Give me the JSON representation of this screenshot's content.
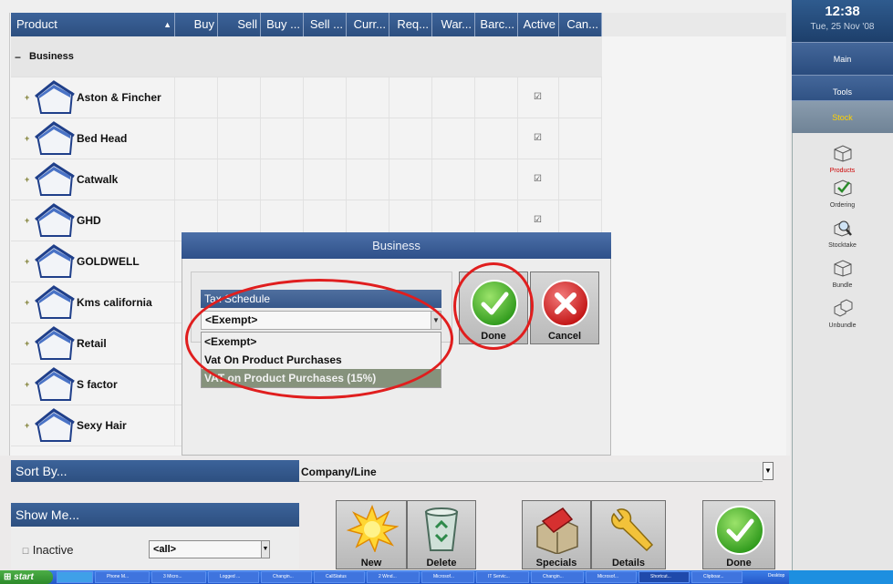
{
  "grid": {
    "columns": [
      "Product",
      "Buy",
      "Sell",
      "Buy ...",
      "Sell ...",
      "Curr...",
      "Req...",
      "War...",
      "Barc...",
      "Active",
      "Can..."
    ],
    "group_label": "Business",
    "rows": [
      {
        "label": "Aston & Fincher",
        "active": true
      },
      {
        "label": "Bed Head",
        "active": true
      },
      {
        "label": "Catwalk",
        "active": true
      },
      {
        "label": "GHD",
        "active": true
      },
      {
        "label": "GOLDWELL",
        "active": false
      },
      {
        "label": "Kms california",
        "active": false
      },
      {
        "label": "Retail",
        "active": false
      },
      {
        "label": "S factor",
        "active": true
      },
      {
        "label": "Sexy Hair",
        "active": true
      }
    ]
  },
  "dialog": {
    "title": "Business",
    "tax_schedule_label": "Tax Schedule",
    "tax_schedule_value": "<Exempt>",
    "options": [
      "<Exempt>",
      "Vat On Product Purchases",
      "VAT on Product Purchases (15%)"
    ],
    "selected_option_index": 2,
    "done_label": "Done",
    "cancel_label": "Cancel"
  },
  "sort": {
    "label": "Sort By...",
    "value": "Company/Line"
  },
  "show": {
    "label": "Show Me...",
    "inactive_label": "Inactive",
    "filter_value": "<all>"
  },
  "toolbar": {
    "new_label": "New",
    "delete_label": "Delete",
    "specials_label": "Specials",
    "details_label": "Details",
    "done_label": "Done"
  },
  "sidebar": {
    "time": "12:38",
    "date": "Tue, 25 Nov '08",
    "buttons": [
      "Main",
      "Tools",
      "Stock"
    ],
    "items": [
      "Products",
      "Ordering",
      "Stocktake",
      "Bundle",
      "Unbundle"
    ]
  },
  "taskbar": {
    "start_label": "start",
    "tasks": [
      "Phone M...",
      "3 Micro...",
      "Logged ...",
      "Changin...",
      "CallStatus",
      "2 Wind...",
      "Microsof...",
      "IT Servic...",
      "Changin...",
      "Microsof...",
      "Shortcut...",
      "Clipboar..."
    ],
    "desktop_label": "Desktop"
  },
  "colors": {
    "header_blue": "#2d4f80",
    "selection_green": "#86927c",
    "annotation_red": "#e01e1e"
  }
}
